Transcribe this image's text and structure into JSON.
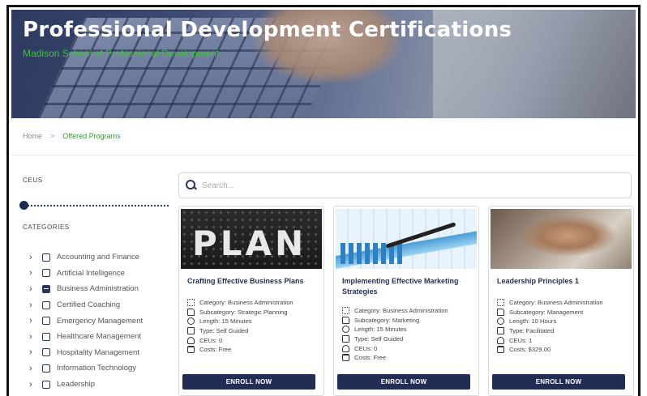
{
  "hero": {
    "title": "Professional Development Certifications",
    "subtitle": "Madison School of Professional Development"
  },
  "breadcrumb": {
    "home": "Home",
    "separator": ">",
    "current": "Offered Programs"
  },
  "filters": {
    "ceus_label": "CEUS",
    "ceus_slider_value": 0,
    "categories_label": "CATEGORIES",
    "categories": [
      {
        "label": "Accounting and Finance",
        "checked": false
      },
      {
        "label": "Artificial Intelligence",
        "checked": false
      },
      {
        "label": "Business Administration",
        "checked": true
      },
      {
        "label": "Certified Coaching",
        "checked": false
      },
      {
        "label": "Emergency Management",
        "checked": false
      },
      {
        "label": "Healthcare Management",
        "checked": false
      },
      {
        "label": "Hospitality Management",
        "checked": false
      },
      {
        "label": "Information Technology",
        "checked": false
      },
      {
        "label": "Leadership",
        "checked": false
      }
    ]
  },
  "search": {
    "placeholder": "Search..."
  },
  "colors": {
    "brand_navy": "#222d55",
    "accent_green": "#3fbf3f"
  },
  "cards": [
    {
      "title": "Crafting Effective Business Plans",
      "image_word": "PLAN",
      "category": "Category: Business Administration",
      "subcategory": "Subcategory: Strategic Planning",
      "length": "Length: 15 Minutes",
      "type": "Type: Self Guided",
      "ceus": "CEUs: 0",
      "costs": "Costs: Free",
      "button": "ENROLL NOW"
    },
    {
      "title": "Implementing Effective Marketing Strategies",
      "category": "Category: Business Administration",
      "subcategory": "Subcategory: Marketing",
      "length": "Length: 15 Minutes",
      "type": "Type: Self Guided",
      "ceus": "CEUs: 0",
      "costs": "Costs: Free",
      "button": "ENROLL NOW"
    },
    {
      "title": "Leadership Principles 1",
      "category": "Category: Business Administration",
      "subcategory": "Subcategory: Management",
      "length": "Length: 10 Hours",
      "type": "Type: Facilitated",
      "ceus": "CEUs: 1",
      "costs": "Costs: $329.00",
      "button": "ENROLL NOW"
    }
  ]
}
